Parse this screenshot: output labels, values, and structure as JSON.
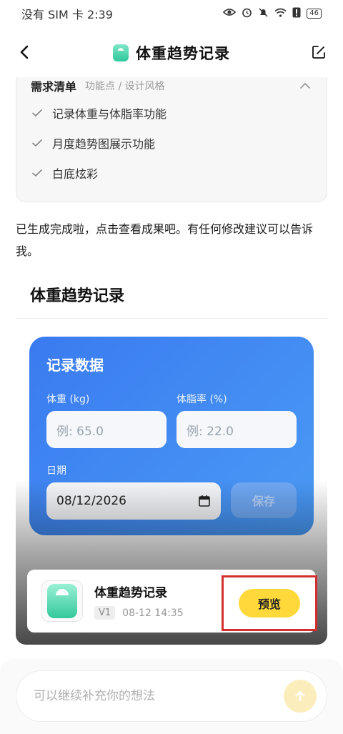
{
  "status_bar": {
    "carrier_time": "没有 SIM 卡 2:39",
    "battery": "46"
  },
  "header": {
    "title": "体重趋势记录"
  },
  "requirements": {
    "title": "需求清单",
    "subtitle": "功能点 / 设计风格",
    "items": [
      "记录体重与体脂率功能",
      "月度趋势图展示功能",
      "白底炫彩"
    ]
  },
  "message": "已生成完成啦，点击查看成果吧。有任何修改建议可以告诉我。",
  "section_title": "体重趋势记录",
  "preview": {
    "card_title": "记录数据",
    "weight_label": "体重 (kg)",
    "weight_placeholder": "例: 65.0",
    "bodyfat_label": "体脂率 (%)",
    "bodyfat_placeholder": "例: 22.0",
    "date_label": "日期",
    "date_value": "08/12/2026",
    "save_label": "保存"
  },
  "app_card": {
    "name": "体重趋势记录",
    "version": "V1",
    "timestamp": "08-12 14:35",
    "preview_label": "预览"
  },
  "input": {
    "placeholder": "可以继续补充你的想法"
  }
}
